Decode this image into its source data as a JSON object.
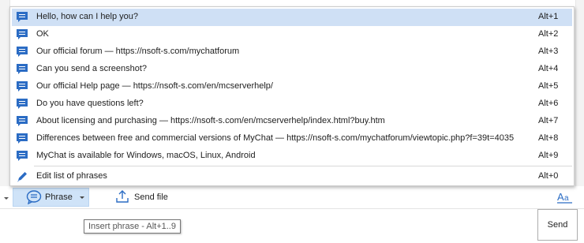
{
  "menu": {
    "items": [
      {
        "label": "Hello, how can I help you?",
        "shortcut": "Alt+1",
        "icon": "chat-bubble-icon"
      },
      {
        "label": "OK",
        "shortcut": "Alt+2",
        "icon": "chat-bubble-icon"
      },
      {
        "label": "Our official forum — https://nsoft-s.com/mychatforum",
        "shortcut": "Alt+3",
        "icon": "chat-bubble-icon"
      },
      {
        "label": "Can you send a screenshot?",
        "shortcut": "Alt+4",
        "icon": "chat-bubble-icon"
      },
      {
        "label": "Our official Help page — https://nsoft-s.com/en/mcserverhelp/",
        "shortcut": "Alt+5",
        "icon": "chat-bubble-icon"
      },
      {
        "label": "Do you have questions left?",
        "shortcut": "Alt+6",
        "icon": "chat-bubble-icon"
      },
      {
        "label": "About licensing and purchasing — https://nsoft-s.com/en/mcserverhelp/index.html?buy.htm",
        "shortcut": "Alt+7",
        "icon": "chat-bubble-icon"
      },
      {
        "label": "Differences between free and commercial versions of MyChat — https://nsoft-s.com/mychatforum/viewtopic.php?f=39t=4035",
        "shortcut": "Alt+8",
        "icon": "chat-bubble-icon"
      },
      {
        "label": "MyChat is available for Windows, macOS, Linux, Android",
        "shortcut": "Alt+9",
        "icon": "chat-bubble-icon"
      }
    ],
    "edit_item": {
      "label": "Edit list of phrases",
      "shortcut": "Alt+0",
      "icon": "pencil-icon"
    },
    "selected_index": 0
  },
  "toolbar": {
    "phrase_label": "Phrase",
    "send_file_label": "Send file",
    "font_icon": "font-aa-icon"
  },
  "send_button": {
    "label": "Send"
  },
  "tooltip": {
    "text": "Insert phrase - Alt+1..9"
  },
  "colors": {
    "accent_icon": "#2b6cc4",
    "selection": "#cfe0f5",
    "phrase_button": "#cfe3f8"
  }
}
